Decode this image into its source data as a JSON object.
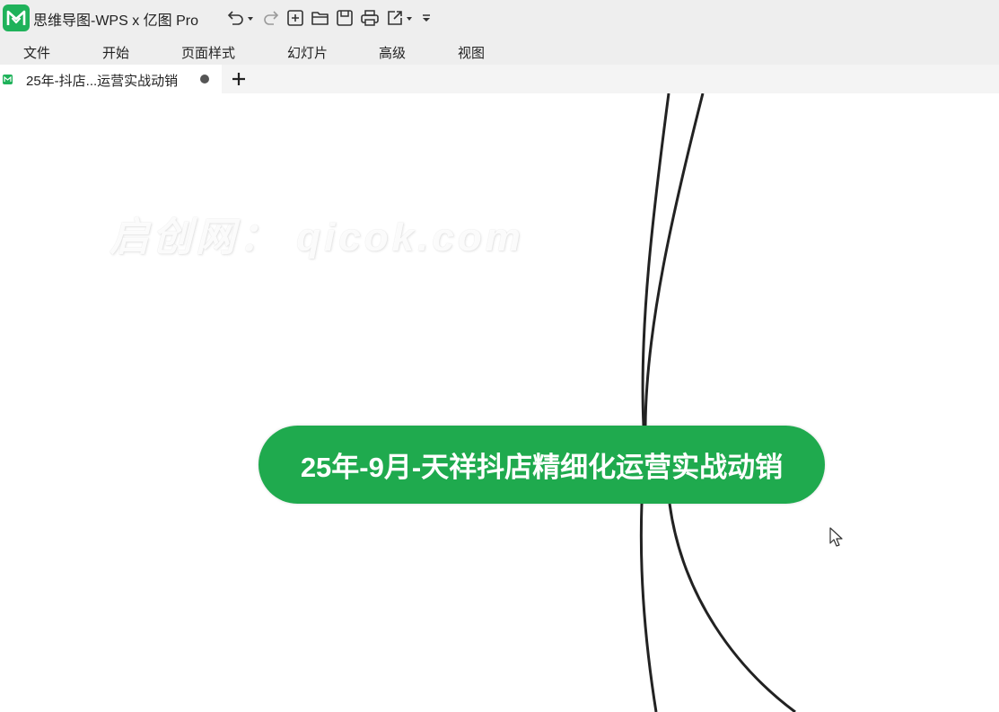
{
  "app": {
    "title": "思维导图-WPS x 亿图 Pro",
    "accent_color": "#1fb25a"
  },
  "quick_access": [
    {
      "name": "undo-icon"
    },
    {
      "name": "redo-icon"
    },
    {
      "name": "new-icon"
    },
    {
      "name": "open-folder-icon"
    },
    {
      "name": "save-icon"
    },
    {
      "name": "print-icon"
    },
    {
      "name": "export-icon"
    },
    {
      "name": "customize-toolbar-icon"
    }
  ],
  "menu": {
    "items": [
      "文件",
      "开始",
      "页面样式",
      "幻灯片",
      "高级",
      "视图"
    ]
  },
  "tabs": {
    "active_label": "25年-抖店...运营实战动销",
    "unsaved_indicator": "dot-icon",
    "new_tab_icon": "plus-icon"
  },
  "canvas": {
    "watermark": "启创网： qicok.com",
    "root_topic": "25年-9月-天祥抖店精细化运营实战动销",
    "root_color": "#1faa4e"
  }
}
